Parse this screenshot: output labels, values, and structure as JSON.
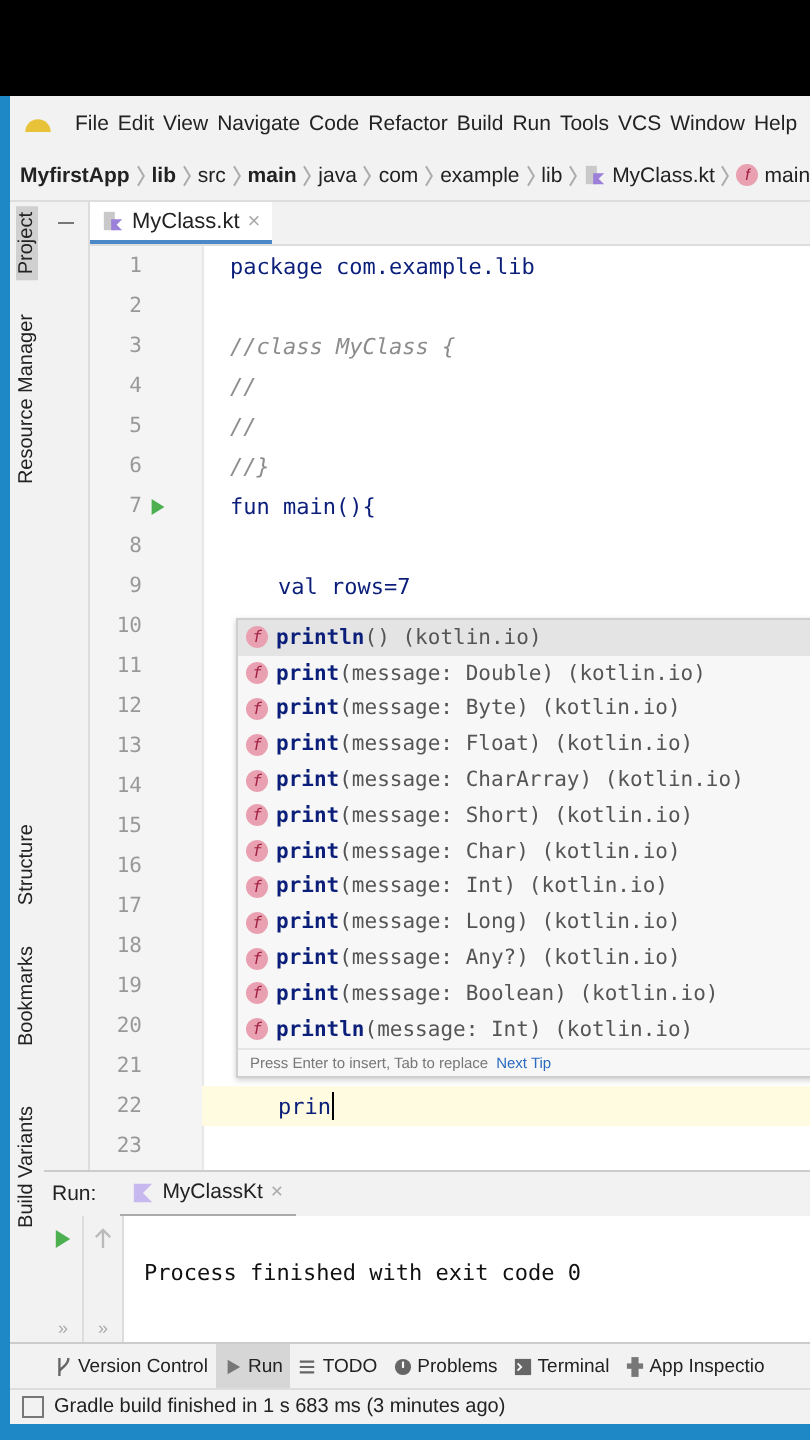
{
  "menu": [
    "File",
    "Edit",
    "View",
    "Navigate",
    "Code",
    "Refactor",
    "Build",
    "Run",
    "Tools",
    "VCS",
    "Window",
    "Help"
  ],
  "breadcrumb": [
    {
      "label": "MyfirstApp",
      "kind": "bold"
    },
    {
      "label": "lib",
      "kind": "bold"
    },
    {
      "label": "src",
      "kind": "plain"
    },
    {
      "label": "main",
      "kind": "bold"
    },
    {
      "label": "java",
      "kind": "plain"
    },
    {
      "label": "com",
      "kind": "plain"
    },
    {
      "label": "example",
      "kind": "plain"
    },
    {
      "label": "lib",
      "kind": "plain"
    },
    {
      "label": "MyClass.kt",
      "kind": "file"
    },
    {
      "label": "main",
      "kind": "function",
      "badge": "f"
    }
  ],
  "side_labels": [
    {
      "label": "Project",
      "selected": true
    },
    {
      "label": "Resource Manager",
      "selected": false
    },
    {
      "label": "Structure",
      "selected": false
    },
    {
      "label": "Bookmarks",
      "selected": false
    },
    {
      "label": "Build Variants",
      "selected": false
    }
  ],
  "editor_tab": {
    "label": "MyClass.kt",
    "close": "×"
  },
  "lines": [
    {
      "number": "1",
      "code": "package com.example.lib",
      "kind": "keyword-start"
    },
    {
      "number": "2"
    },
    {
      "number": "3",
      "code": "//class MyClass {",
      "kind": "comment"
    },
    {
      "number": "4",
      "code": "//",
      "kind": "comment"
    },
    {
      "number": "5",
      "code": "//",
      "kind": "comment"
    },
    {
      "number": "6",
      "code": "//}",
      "kind": "comment"
    },
    {
      "number": "7",
      "code": "fun main(){",
      "kind": "keyword-start",
      "run": true
    },
    {
      "number": "8"
    },
    {
      "number": "9",
      "code": "val rows=7",
      "kind": "keyword-start",
      "indent": true
    },
    {
      "number": "10"
    },
    {
      "number": "11"
    },
    {
      "number": "12"
    },
    {
      "number": "13"
    },
    {
      "number": "14"
    },
    {
      "number": "15"
    },
    {
      "number": "16"
    },
    {
      "number": "17"
    },
    {
      "number": "18"
    },
    {
      "number": "19"
    },
    {
      "number": "20"
    },
    {
      "number": "21"
    },
    {
      "number": "22",
      "code": "prin",
      "kind": "plain",
      "indent": true,
      "current": true
    },
    {
      "number": "23"
    }
  ],
  "completion": {
    "items": [
      {
        "badge": "f",
        "name": "println",
        "tail": "() (kotlin.io)",
        "selected": true
      },
      {
        "badge": "f",
        "name": "print",
        "tail": "(message: Double) (kotlin.io)",
        "selected": false
      },
      {
        "badge": "f",
        "name": "print",
        "tail": "(message: Byte) (kotlin.io)",
        "selected": false
      },
      {
        "badge": "f",
        "name": "print",
        "tail": "(message: Float) (kotlin.io)",
        "selected": false
      },
      {
        "badge": "f",
        "name": "print",
        "tail": "(message: CharArray) (kotlin.io)",
        "selected": false
      },
      {
        "badge": "f",
        "name": "print",
        "tail": "(message: Short) (kotlin.io)",
        "selected": false
      },
      {
        "badge": "f",
        "name": "print",
        "tail": "(message: Char) (kotlin.io)",
        "selected": false
      },
      {
        "badge": "f",
        "name": "print",
        "tail": "(message: Int) (kotlin.io)",
        "selected": false
      },
      {
        "badge": "f",
        "name": "print",
        "tail": "(message: Long) (kotlin.io)",
        "selected": false
      },
      {
        "badge": "f",
        "name": "print",
        "tail": "(message: Any?) (kotlin.io)",
        "selected": false
      },
      {
        "badge": "f",
        "name": "print",
        "tail": "(message: Boolean) (kotlin.io)",
        "selected": false
      },
      {
        "badge": "f",
        "name": "println",
        "tail": "(message: Int) (kotlin.io)",
        "selected": false
      }
    ],
    "hint": "Press Enter to insert, Tab to replace",
    "hint_link": "Next Tip"
  },
  "run_panel": {
    "label": "Run:",
    "tab": "MyClassKt",
    "close": "×",
    "output": "Process finished with exit code 0",
    "more": "»"
  },
  "tool_tabs": [
    {
      "label": "Version Control",
      "selected": false
    },
    {
      "label": "Run",
      "selected": true
    },
    {
      "label": "TODO",
      "selected": false
    },
    {
      "label": "Problems",
      "selected": false
    },
    {
      "label": "Terminal",
      "selected": false
    },
    {
      "label": "App Inspectio",
      "selected": false
    }
  ],
  "status_bar": "Gradle build finished in 1 s 683 ms (3 minutes ago)"
}
